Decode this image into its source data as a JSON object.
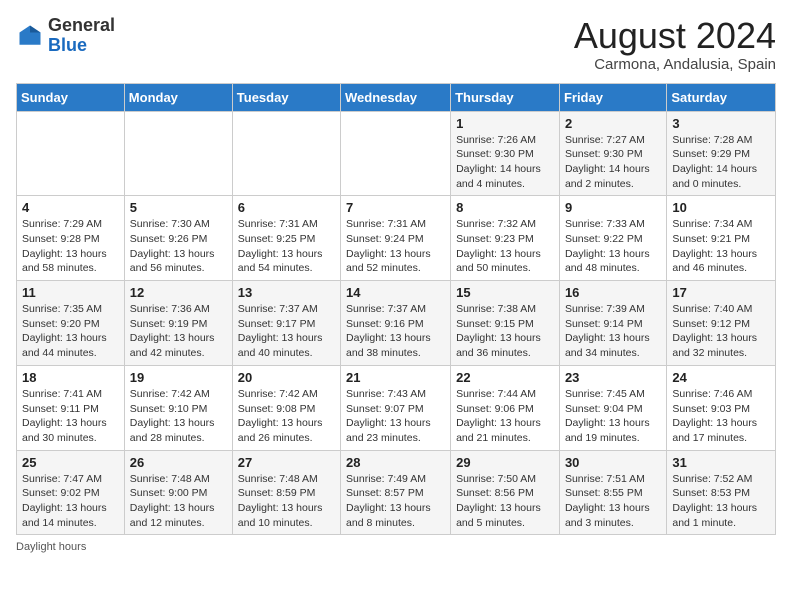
{
  "header": {
    "logo_general": "General",
    "logo_blue": "Blue",
    "month_year": "August 2024",
    "location": "Carmona, Andalusia, Spain"
  },
  "weekdays": [
    "Sunday",
    "Monday",
    "Tuesday",
    "Wednesday",
    "Thursday",
    "Friday",
    "Saturday"
  ],
  "weeks": [
    [
      {
        "day": "",
        "sunrise": "",
        "sunset": "",
        "daylight": ""
      },
      {
        "day": "",
        "sunrise": "",
        "sunset": "",
        "daylight": ""
      },
      {
        "day": "",
        "sunrise": "",
        "sunset": "",
        "daylight": ""
      },
      {
        "day": "",
        "sunrise": "",
        "sunset": "",
        "daylight": ""
      },
      {
        "day": "1",
        "sunrise": "Sunrise: 7:26 AM",
        "sunset": "Sunset: 9:30 PM",
        "daylight": "Daylight: 14 hours and 4 minutes."
      },
      {
        "day": "2",
        "sunrise": "Sunrise: 7:27 AM",
        "sunset": "Sunset: 9:30 PM",
        "daylight": "Daylight: 14 hours and 2 minutes."
      },
      {
        "day": "3",
        "sunrise": "Sunrise: 7:28 AM",
        "sunset": "Sunset: 9:29 PM",
        "daylight": "Daylight: 14 hours and 0 minutes."
      }
    ],
    [
      {
        "day": "4",
        "sunrise": "Sunrise: 7:29 AM",
        "sunset": "Sunset: 9:28 PM",
        "daylight": "Daylight: 13 hours and 58 minutes."
      },
      {
        "day": "5",
        "sunrise": "Sunrise: 7:30 AM",
        "sunset": "Sunset: 9:26 PM",
        "daylight": "Daylight: 13 hours and 56 minutes."
      },
      {
        "day": "6",
        "sunrise": "Sunrise: 7:31 AM",
        "sunset": "Sunset: 9:25 PM",
        "daylight": "Daylight: 13 hours and 54 minutes."
      },
      {
        "day": "7",
        "sunrise": "Sunrise: 7:31 AM",
        "sunset": "Sunset: 9:24 PM",
        "daylight": "Daylight: 13 hours and 52 minutes."
      },
      {
        "day": "8",
        "sunrise": "Sunrise: 7:32 AM",
        "sunset": "Sunset: 9:23 PM",
        "daylight": "Daylight: 13 hours and 50 minutes."
      },
      {
        "day": "9",
        "sunrise": "Sunrise: 7:33 AM",
        "sunset": "Sunset: 9:22 PM",
        "daylight": "Daylight: 13 hours and 48 minutes."
      },
      {
        "day": "10",
        "sunrise": "Sunrise: 7:34 AM",
        "sunset": "Sunset: 9:21 PM",
        "daylight": "Daylight: 13 hours and 46 minutes."
      }
    ],
    [
      {
        "day": "11",
        "sunrise": "Sunrise: 7:35 AM",
        "sunset": "Sunset: 9:20 PM",
        "daylight": "Daylight: 13 hours and 44 minutes."
      },
      {
        "day": "12",
        "sunrise": "Sunrise: 7:36 AM",
        "sunset": "Sunset: 9:19 PM",
        "daylight": "Daylight: 13 hours and 42 minutes."
      },
      {
        "day": "13",
        "sunrise": "Sunrise: 7:37 AM",
        "sunset": "Sunset: 9:17 PM",
        "daylight": "Daylight: 13 hours and 40 minutes."
      },
      {
        "day": "14",
        "sunrise": "Sunrise: 7:37 AM",
        "sunset": "Sunset: 9:16 PM",
        "daylight": "Daylight: 13 hours and 38 minutes."
      },
      {
        "day": "15",
        "sunrise": "Sunrise: 7:38 AM",
        "sunset": "Sunset: 9:15 PM",
        "daylight": "Daylight: 13 hours and 36 minutes."
      },
      {
        "day": "16",
        "sunrise": "Sunrise: 7:39 AM",
        "sunset": "Sunset: 9:14 PM",
        "daylight": "Daylight: 13 hours and 34 minutes."
      },
      {
        "day": "17",
        "sunrise": "Sunrise: 7:40 AM",
        "sunset": "Sunset: 9:12 PM",
        "daylight": "Daylight: 13 hours and 32 minutes."
      }
    ],
    [
      {
        "day": "18",
        "sunrise": "Sunrise: 7:41 AM",
        "sunset": "Sunset: 9:11 PM",
        "daylight": "Daylight: 13 hours and 30 minutes."
      },
      {
        "day": "19",
        "sunrise": "Sunrise: 7:42 AM",
        "sunset": "Sunset: 9:10 PM",
        "daylight": "Daylight: 13 hours and 28 minutes."
      },
      {
        "day": "20",
        "sunrise": "Sunrise: 7:42 AM",
        "sunset": "Sunset: 9:08 PM",
        "daylight": "Daylight: 13 hours and 26 minutes."
      },
      {
        "day": "21",
        "sunrise": "Sunrise: 7:43 AM",
        "sunset": "Sunset: 9:07 PM",
        "daylight": "Daylight: 13 hours and 23 minutes."
      },
      {
        "day": "22",
        "sunrise": "Sunrise: 7:44 AM",
        "sunset": "Sunset: 9:06 PM",
        "daylight": "Daylight: 13 hours and 21 minutes."
      },
      {
        "day": "23",
        "sunrise": "Sunrise: 7:45 AM",
        "sunset": "Sunset: 9:04 PM",
        "daylight": "Daylight: 13 hours and 19 minutes."
      },
      {
        "day": "24",
        "sunrise": "Sunrise: 7:46 AM",
        "sunset": "Sunset: 9:03 PM",
        "daylight": "Daylight: 13 hours and 17 minutes."
      }
    ],
    [
      {
        "day": "25",
        "sunrise": "Sunrise: 7:47 AM",
        "sunset": "Sunset: 9:02 PM",
        "daylight": "Daylight: 13 hours and 14 minutes."
      },
      {
        "day": "26",
        "sunrise": "Sunrise: 7:48 AM",
        "sunset": "Sunset: 9:00 PM",
        "daylight": "Daylight: 13 hours and 12 minutes."
      },
      {
        "day": "27",
        "sunrise": "Sunrise: 7:48 AM",
        "sunset": "Sunset: 8:59 PM",
        "daylight": "Daylight: 13 hours and 10 minutes."
      },
      {
        "day": "28",
        "sunrise": "Sunrise: 7:49 AM",
        "sunset": "Sunset: 8:57 PM",
        "daylight": "Daylight: 13 hours and 8 minutes."
      },
      {
        "day": "29",
        "sunrise": "Sunrise: 7:50 AM",
        "sunset": "Sunset: 8:56 PM",
        "daylight": "Daylight: 13 hours and 5 minutes."
      },
      {
        "day": "30",
        "sunrise": "Sunrise: 7:51 AM",
        "sunset": "Sunset: 8:55 PM",
        "daylight": "Daylight: 13 hours and 3 minutes."
      },
      {
        "day": "31",
        "sunrise": "Sunrise: 7:52 AM",
        "sunset": "Sunset: 8:53 PM",
        "daylight": "Daylight: 13 hours and 1 minute."
      }
    ]
  ],
  "footer": {
    "daylight_hours_label": "Daylight hours"
  }
}
